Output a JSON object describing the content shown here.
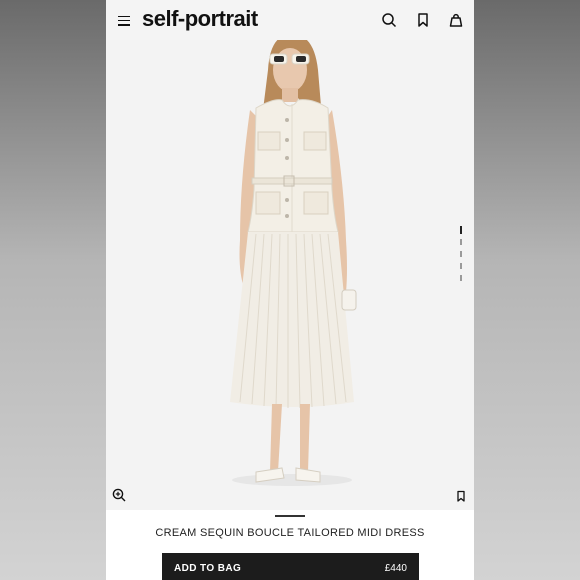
{
  "header": {
    "brand": "self-portrait",
    "icons": [
      "menu-icon",
      "search-icon",
      "bookmark-icon",
      "bag-icon"
    ]
  },
  "gallery": {
    "image_description_icons": [
      "zoom-in-icon",
      "bookmark-icon"
    ],
    "pager_count": 5,
    "pager_active": 0
  },
  "product": {
    "title": "CREAM SEQUIN BOUCLE TAILORED MIDI DRESS",
    "add_to_bag_label": "ADD TO BAG",
    "price": "£440"
  },
  "colors": {
    "accent": "#1c1c1c",
    "page_bg": "#f4f4f4",
    "garment": "#f3efe6"
  }
}
